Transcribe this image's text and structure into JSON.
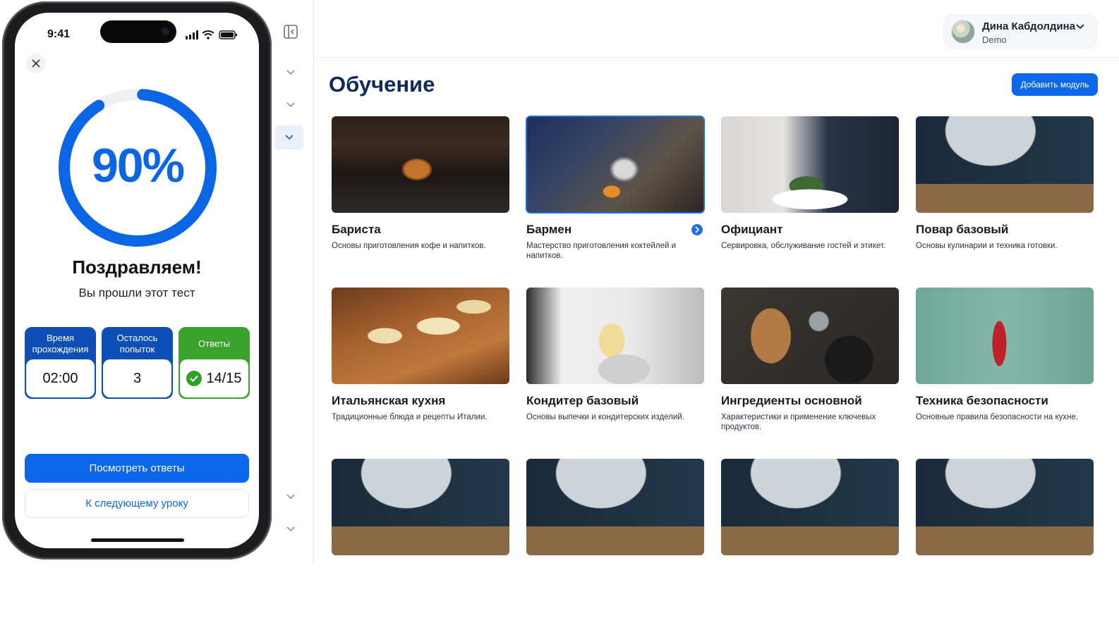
{
  "header": {
    "user_name": "Дина Кабдолдина",
    "user_sub": "Demo"
  },
  "main": {
    "title": "Обучение",
    "add_button": "Добавить модуль",
    "cards": [
      {
        "title": "Бариста",
        "desc": "Основы приготовления кофе и напитков."
      },
      {
        "title": "Бармен",
        "desc": "Мастерство приготовления коктейлей и напитков.",
        "selected": true
      },
      {
        "title": "Официант",
        "desc": "Сервировка, обслуживание гостей и этикет."
      },
      {
        "title": "Повар базовый",
        "desc": "Основы кулинарии и техника готовки."
      },
      {
        "title": "Итальянская кухня",
        "desc": "Традиционные блюда и рецепты Италии."
      },
      {
        "title": "Кондитер базовый",
        "desc": "Основы выпечки и кондитерских изделий."
      },
      {
        "title": "Ингредиенты основной",
        "desc": "Характеристики и применение ключевых продуктов."
      },
      {
        "title": "Техника безопасности",
        "desc": "Основные правила безопасности на кухне."
      }
    ]
  },
  "phone": {
    "time": "9:41",
    "progress_label": "90%",
    "progress_value": 0.9,
    "congrats": "Поздравляем!",
    "passed": "Вы прошли этот тест",
    "stats": [
      {
        "label": "Время прохождения",
        "value": "02:00"
      },
      {
        "label": "Осталось попыток",
        "value": "3"
      },
      {
        "label": "Ответы",
        "value": "14/15"
      }
    ],
    "view_answers": "Посмотреть ответы",
    "next_lesson": "К следующему уроку"
  },
  "colors": {
    "accent": "#0b68e8",
    "title": "#0f2a5a",
    "stat_header": "#0d4fb6",
    "success": "#3aa32b"
  },
  "icons": {
    "sidebar_toggle": "sidebar-collapse-icon",
    "chevrons": "chevron-down-icon",
    "close": "close-icon",
    "check": "check-icon"
  }
}
